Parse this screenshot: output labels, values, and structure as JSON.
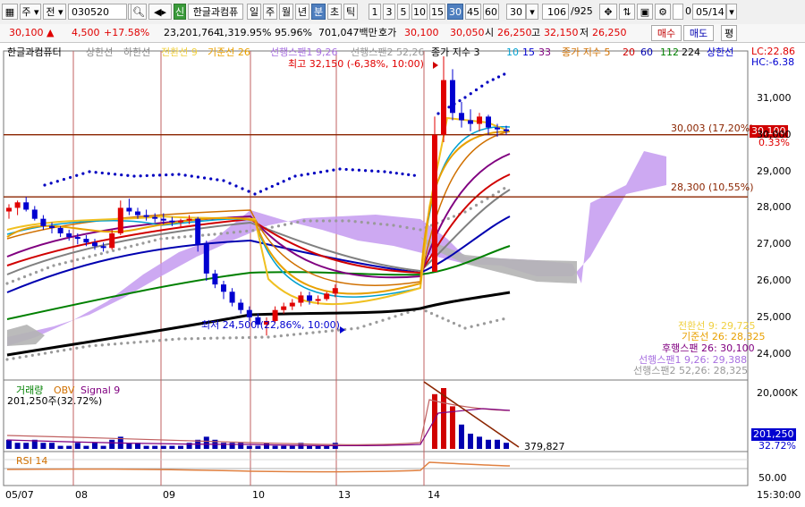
{
  "toolbar": {
    "menu_icon": "chart-menu-icon",
    "type_label": "주",
    "prev_label": "전",
    "code_value": "030520",
    "stock_badge": "신",
    "stock_name": "한글과컴퓨",
    "periods": [
      "일",
      "주",
      "월",
      "년",
      "분",
      "초",
      "틱"
    ],
    "active_period": "분",
    "intervals": [
      "1",
      "3",
      "5",
      "10",
      "15",
      "30",
      "45",
      "60"
    ],
    "active_interval": "30",
    "interval_select": "30",
    "count_value": "106",
    "count_total": "/925",
    "checkbox_value": "0",
    "date_value": "05/14"
  },
  "quote": {
    "price": "30,100",
    "arrow": "▲",
    "change": "4,500",
    "change_pct": "+17.58%",
    "volume": "23,201,764",
    "volume_pct": "1,319.95%",
    "ratio": "95.96%",
    "amount": "701,047백만",
    "ask_label": "호가",
    "ask": "30,100",
    "bid": "30,050",
    "high_label": "시",
    "open": "26,250",
    "hi_label": "고",
    "high": "32,150",
    "low_label": "저",
    "low": "26,250",
    "buy_button": "매수",
    "sell_button": "매도",
    "eval_button": "평"
  },
  "legend": {
    "name": "한글과컴퓨터",
    "upper": "상한선",
    "lower": "하한선",
    "conversion": "전환선 9",
    "base": "기준선 26",
    "lead1": "선행스팬1 9,26",
    "lead2": "선행스팬2 52,26",
    "close_ma": "종가 지수 3",
    "ma10": "10",
    "ma15": "15",
    "ma33": "33",
    "close_ma2": "종가 지수 5",
    "ma20": "20",
    "ma60": "60",
    "ma112": "112",
    "ma224": "224",
    "upperlimit": "상한선"
  },
  "annotations": {
    "high_note": "최고 32,150 (-6,38%, 10:00)",
    "low_note": "최저 24,500 (22,86%, 10:00)",
    "line1": "30,003 (17,20%)",
    "line2": "28,300 (10,55%)",
    "lc": "LC:22.86",
    "hc": "HC:-6.38",
    "current_box": "30,100",
    "current_pct": "0.33%"
  },
  "ichimoku_values": {
    "conversion": "전환선 9: 29,725",
    "base": "기준선 26: 28,325",
    "lagging": "후행스팬 26: 30,100",
    "lead1": "선행스팬1 9,26: 29,388",
    "lead2": "선행스팬2 52,26: 28,325"
  },
  "volume_panel": {
    "title": "거래량",
    "obv": "OBV",
    "signal": "Signal 9",
    "value": "201,250주(32.72%)",
    "max_label": "20,000K",
    "current_box": "201,250",
    "current_pct": "32.72%",
    "trend_value": "379,827"
  },
  "rsi_panel": {
    "title": "RSI 14",
    "level": "50.00"
  },
  "x_axis": {
    "labels": [
      "05/07",
      "08",
      "09",
      "10",
      "13",
      "14"
    ],
    "time": "15:30:00"
  },
  "y_axis": {
    "labels": [
      "31,000",
      "30,000",
      "29,000",
      "28,000",
      "27,000",
      "26,000",
      "25,000",
      "24,000"
    ]
  },
  "colors": {
    "up": "#e00000",
    "down": "#0000d0",
    "cloud": "#c08cf0",
    "cloud_gray": "#b4b4b4",
    "selected": "#4f7fbf"
  },
  "chart_data": {
    "type": "candlestick",
    "title": "한글과컴퓨터",
    "y_range": [
      23600,
      32200
    ],
    "x_categories": [
      "05/07",
      "08",
      "09",
      "10",
      "13",
      "14"
    ],
    "candles": [
      [
        27900,
        28100,
        27700,
        28000
      ],
      [
        28000,
        28200,
        27800,
        28150
      ],
      [
        28150,
        28300,
        27900,
        27950
      ],
      [
        27950,
        28050,
        27650,
        27700
      ],
      [
        27700,
        27800,
        27400,
        27500
      ],
      [
        27500,
        27600,
        27300,
        27450
      ],
      [
        27450,
        27500,
        27200,
        27300
      ],
      [
        27300,
        27400,
        27100,
        27200
      ],
      [
        27200,
        27300,
        27000,
        27150
      ],
      [
        27150,
        27250,
        26950,
        27050
      ],
      [
        27050,
        27150,
        26850,
        26950
      ],
      [
        26950,
        27050,
        26800,
        26900
      ],
      [
        26900,
        27400,
        26850,
        27300
      ],
      [
        27300,
        28200,
        27250,
        28000
      ],
      [
        28000,
        28250,
        27800,
        27900
      ],
      [
        27900,
        28000,
        27700,
        27800
      ],
      [
        27800,
        27950,
        27650,
        27750
      ],
      [
        27750,
        27850,
        27600,
        27700
      ],
      [
        27700,
        27850,
        27550,
        27650
      ],
      [
        27650,
        27750,
        27500,
        27600
      ],
      [
        27600,
        27700,
        27450,
        27650
      ],
      [
        27650,
        27800,
        27550,
        27700
      ],
      [
        27700,
        27750,
        26800,
        27000
      ],
      [
        27000,
        27100,
        26000,
        26200
      ],
      [
        26200,
        26300,
        25800,
        25900
      ],
      [
        25900,
        26000,
        25500,
        25700
      ],
      [
        25700,
        25800,
        25300,
        25400
      ],
      [
        25400,
        25500,
        25100,
        25200
      ],
      [
        25200,
        25300,
        24900,
        25000
      ],
      [
        25000,
        25100,
        24700,
        24800
      ],
      [
        24800,
        25000,
        24500,
        24900
      ],
      [
        24900,
        25300,
        24850,
        25200
      ],
      [
        25200,
        25400,
        25100,
        25300
      ],
      [
        25300,
        25500,
        25200,
        25400
      ],
      [
        25400,
        25700,
        25300,
        25600
      ],
      [
        25600,
        25700,
        25350,
        25450
      ],
      [
        25450,
        25600,
        25350,
        25500
      ],
      [
        25500,
        25700,
        25450,
        25650
      ],
      [
        25650,
        25900,
        25550,
        25800
      ],
      [
        26250,
        30500,
        26250,
        30000
      ],
      [
        30000,
        32150,
        29800,
        31500
      ],
      [
        31500,
        31800,
        30400,
        30600
      ],
      [
        30600,
        30900,
        30200,
        30400
      ],
      [
        30400,
        30700,
        30100,
        30300
      ],
      [
        30300,
        30600,
        30100,
        30500
      ],
      [
        30500,
        30550,
        30000,
        30200
      ],
      [
        30200,
        30300,
        29950,
        30150
      ],
      [
        30150,
        30250,
        30000,
        30100
      ]
    ],
    "volume": [
      3,
      2,
      2,
      3,
      2,
      2,
      1,
      1,
      2,
      1,
      2,
      1,
      3,
      4,
      2,
      2,
      1,
      1,
      1,
      1,
      1,
      2,
      3,
      4,
      3,
      2,
      2,
      2,
      1,
      1,
      2,
      1,
      1,
      1,
      2,
      1,
      1,
      1,
      2,
      18,
      20,
      14,
      8,
      5,
      4,
      3,
      3,
      2
    ],
    "unit_note": "volume in relative units (thousands K approx)"
  }
}
